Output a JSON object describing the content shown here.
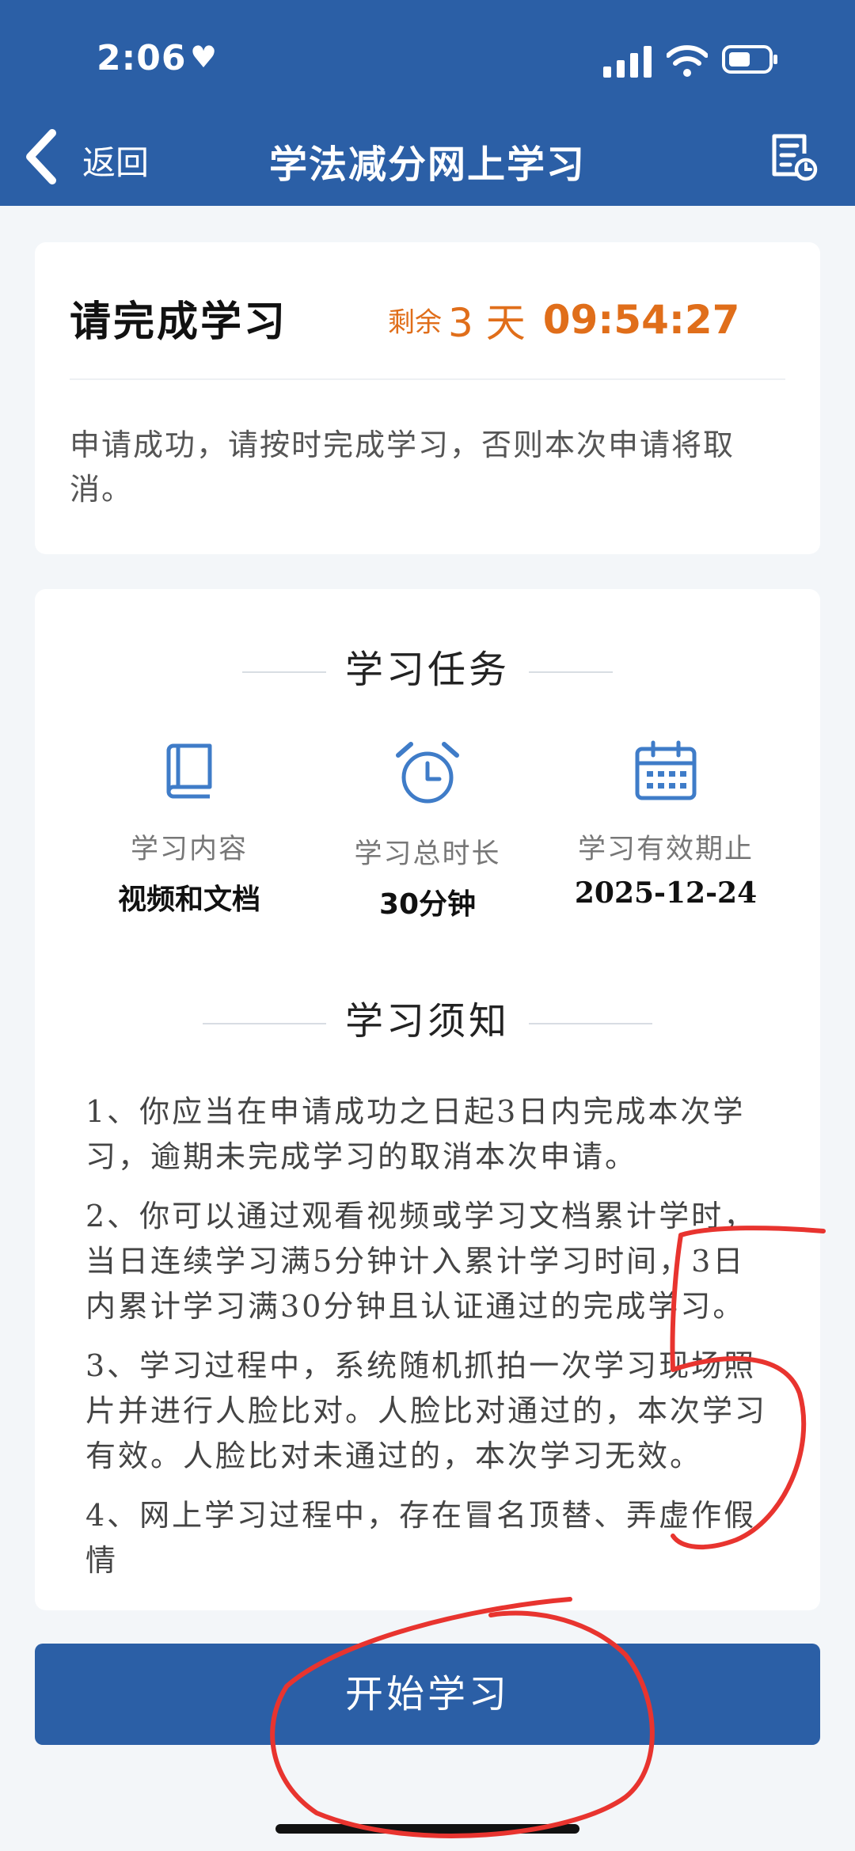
{
  "status_bar": {
    "time": "2:06",
    "heart": "♥"
  },
  "nav": {
    "back_label": "返回",
    "title": "学法减分网上学习"
  },
  "card1": {
    "title": "请完成学习",
    "countdown_label": "剩余",
    "countdown_days": "3 天",
    "countdown_time": "09:54:27",
    "message": "申请成功，请按时完成学习，否则本次申请将取消。"
  },
  "tasks": {
    "section_title": "学习任务",
    "items": [
      {
        "icon": "book-icon",
        "label": "学习内容",
        "value": "视频和文档"
      },
      {
        "icon": "alarm-clock-icon",
        "label": "学习总时长",
        "value": "30分钟"
      },
      {
        "icon": "calendar-icon",
        "label": "学习有效期止",
        "value": "2025-12-24"
      }
    ]
  },
  "notice": {
    "section_title": "学习须知",
    "items": [
      "1、你应当在申请成功之日起3日内完成本次学习，逾期未完成学习的取消本次申请。",
      "2、你可以通过观看视频或学习文档累计学时，当日连续学习满5分钟计入累计学习时间，3日内累计学习满30分钟且认证通过的完成学习。",
      "3、学习过程中，系统随机抓拍一次学习现场照片并进行人脸比对。人脸比对通过的，本次学习有效。人脸比对未通过的，本次学习无效。",
      "4、网上学习过程中，存在冒名顶替、弄虚作假情"
    ]
  },
  "button": {
    "start_label": "开始学习"
  },
  "annotation": {
    "handwritten_number": "5"
  },
  "colors": {
    "primary": "#2b5fa6",
    "countdown": "#e06e1a",
    "annotation": "#e8342f"
  }
}
